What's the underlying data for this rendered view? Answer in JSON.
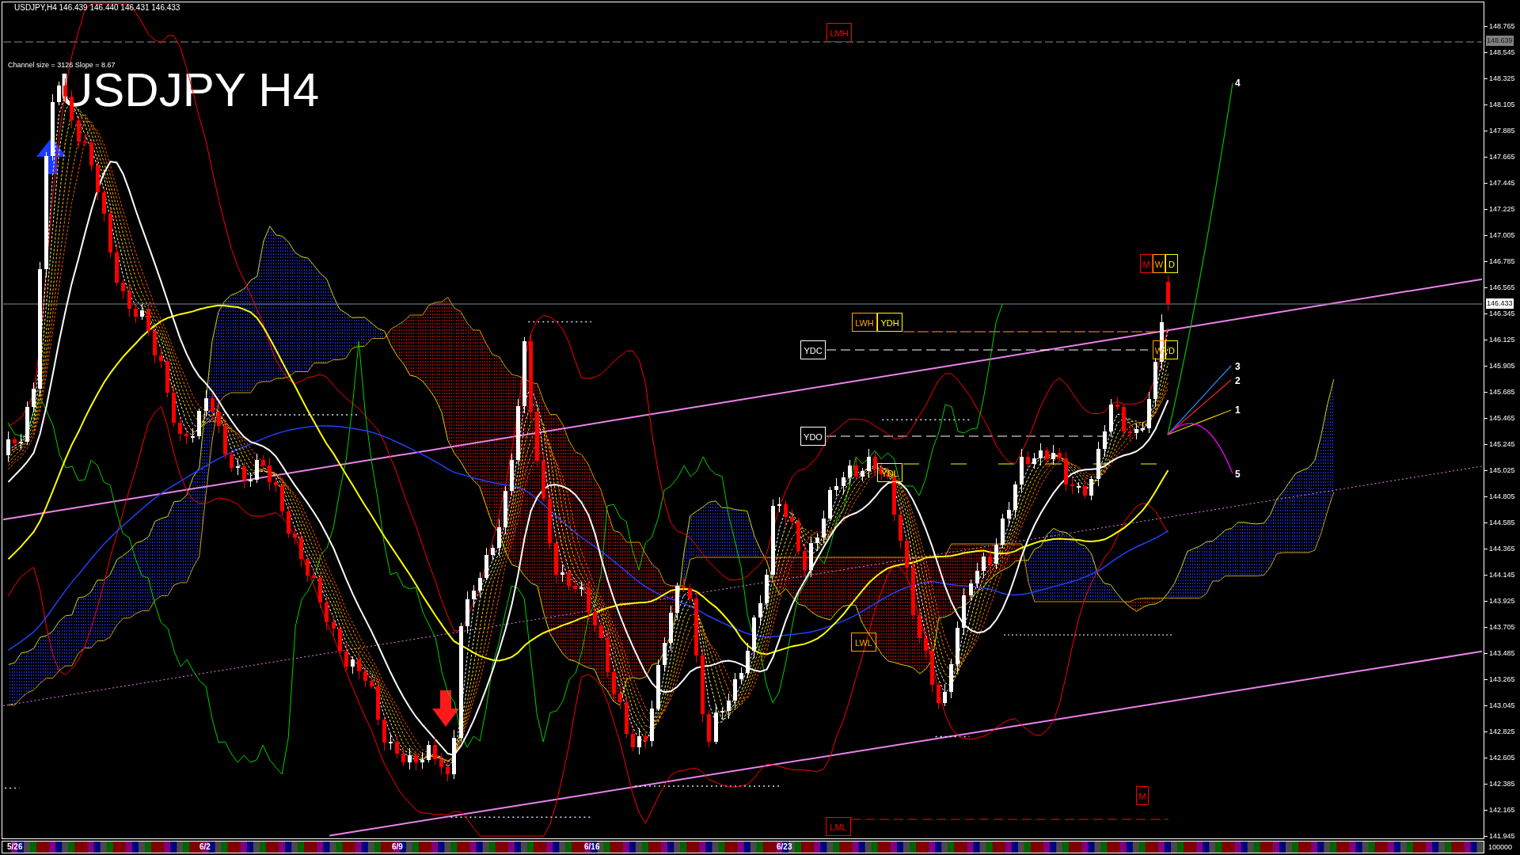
{
  "header": {
    "symbol": "USDJPY,H4",
    "prices": [
      "146.439",
      "146.440",
      "146.431",
      "146.433"
    ]
  },
  "channel_info": "Channel size = 3126 Slope = 8.67",
  "title": "USDJPY H4",
  "levels": [
    {
      "kind": "month_high",
      "tags": [
        {
          "text": "LMH",
          "color": "#ff0000"
        }
      ]
    },
    {
      "kind": "week_high",
      "tags": [
        {
          "text": "LWH",
          "color": "#ffa500"
        },
        {
          "text": "YDH",
          "color": "#ffff00"
        }
      ]
    },
    {
      "kind": "day_close",
      "tags": [
        {
          "text": "YDC",
          "color": "#ffffff"
        }
      ]
    },
    {
      "kind": "day_open",
      "tags": [
        {
          "text": "YDO",
          "color": "#ffffff"
        }
      ]
    },
    {
      "kind": "day_low",
      "tags": [
        {
          "text": "YDL",
          "color": "#ffff00"
        }
      ]
    },
    {
      "kind": "week_low",
      "tags": [
        {
          "text": "LWL",
          "color": "#ffa500"
        }
      ]
    },
    {
      "kind": "month_low",
      "tags": [
        {
          "text": "LML",
          "color": "#ff0000"
        }
      ]
    },
    {
      "kind": "marker_top",
      "tags": [
        {
          "text": "M",
          "color": "#ff0000"
        },
        {
          "text": "W",
          "color": "#ffa500"
        },
        {
          "text": "D",
          "color": "#ffff00"
        }
      ]
    },
    {
      "kind": "marker_middle",
      "tags": [
        {
          "text": "W",
          "color": "#ffa500"
        },
        {
          "text": "D",
          "color": "#ffff00"
        }
      ]
    },
    {
      "kind": "marker_bottom",
      "tags": [
        {
          "text": "M",
          "color": "#ff0000"
        }
      ]
    }
  ],
  "projections": [
    {
      "label": "4",
      "color": "#00c000"
    },
    {
      "label": "3",
      "color": "#1e90ff"
    },
    {
      "label": "2",
      "color": "#ff2020"
    },
    {
      "label": "1",
      "color": "#e0c000"
    },
    {
      "label": "5",
      "color": "#ff00ff"
    }
  ],
  "price_axis": {
    "labels": [
      "148.765",
      "148.545",
      "148.325",
      "148.105",
      "147.885",
      "147.665",
      "147.445",
      "147.225",
      "147.005",
      "146.785",
      "146.565",
      "146.345",
      "146.125",
      "145.905",
      "145.685",
      "145.465",
      "145.245",
      "145.025",
      "144.805",
      "144.585",
      "144.365",
      "144.145",
      "143.925",
      "143.705",
      "143.485",
      "143.265",
      "143.045",
      "142.825",
      "142.605",
      "142.385",
      "142.165",
      "141.945"
    ],
    "high_marker": "148.639",
    "current_price": "146.433"
  },
  "time_axis": {
    "labels": [
      "5/26",
      "6/2",
      "6/9",
      "6/16",
      "6/23"
    ]
  },
  "volume_scale": "100000"
}
